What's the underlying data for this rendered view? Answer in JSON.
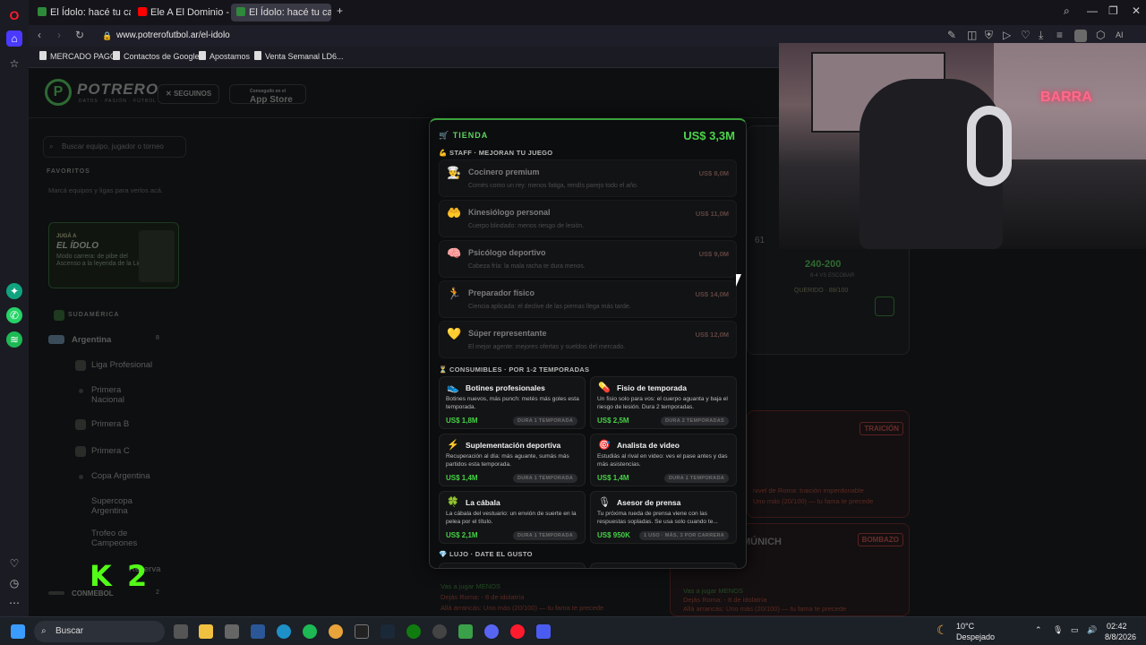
{
  "browser": {
    "tabs": [
      {
        "label": "El Ídolo: hacé tu carrera e",
        "active": false,
        "icon": "potrero-favicon"
      },
      {
        "label": "Ele A El Dominio - Ha",
        "active": false,
        "icon": "youtube-icon"
      },
      {
        "label": "El Ídolo: hacé tu carrera e",
        "active": true,
        "icon": "potrero-favicon"
      }
    ],
    "url": "www.potrerofutbol.ar/el-idolo",
    "bookmarks": [
      "MERCADO PAGO",
      "Contactos de Google",
      "Apostamos",
      "Venta Semanal LD6..."
    ],
    "ai_label": "AI"
  },
  "site": {
    "logo_text": "POTRERO",
    "logo_sub": "DATOS · PASIÓN · FÚTBOL",
    "follow_label": "SEGUINOS",
    "appstore_small": "Conseguilo en el",
    "appstore_label": "App Store",
    "search_placeholder": "Buscar equipo, jugador o torneo",
    "favorites_caption": "FAVORITOS",
    "favorites_note": "Marcá equipos y ligas para verlos acá.",
    "promo": {
      "kicker": "JUGÁ A",
      "title": "EL ÍDOLO",
      "desc": "Modo carrera: de pibe del Ascenso a la leyenda de la Liga"
    },
    "region": "SUDAMÉRICA",
    "country": "Argentina",
    "country_count": "8",
    "nav": [
      "Liga Profesional",
      "Primera Nacional",
      "Primera B",
      "Primera C",
      "Copa Argentina",
      "Supercopa Argentina",
      "Trofeo de Campeones",
      "Reserva"
    ],
    "conmebol": "CONMEBOL",
    "conmebol_count": "2",
    "right_card": {
      "score": "61",
      "record": "240-200",
      "sub": "8-4 VS ESCOBAR",
      "mood": "QUERIDO · 88/100"
    },
    "badges": [
      "TRAICIÓN",
      "BOMBAZO"
    ],
    "munich": "MÚNICH",
    "bg_lines": [
      "nivel de Roma: traición imperdonable",
      "Uno más (20/100) — tu fama te precede",
      "Vas a jugar MENOS",
      "Dejás Roma: - 8 de idolatría",
      "Allá arrancás: Uno más (20/100) — tu fama te precede"
    ]
  },
  "store": {
    "title": "TIENDA",
    "balance": "US$ 3,3M",
    "staff_caption": "STAFF · MEJORAN TU JUEGO",
    "staff": [
      {
        "icon": "chef-icon",
        "glyph": "👨‍🍳",
        "name": "Cocinero premium",
        "desc": "Comés como un rey: menos fatiga, rendís parejo todo el año.",
        "price": "US$ 8,0M"
      },
      {
        "icon": "physio-icon",
        "glyph": "🤲",
        "name": "Kinesiólogo personal",
        "desc": "Cuerpo blindado: menos riesgo de lesión.",
        "price": "US$ 11,0M"
      },
      {
        "icon": "brain-icon",
        "glyph": "🧠",
        "name": "Psicólogo deportivo",
        "desc": "Cabeza fría: la mala racha te dura menos.",
        "price": "US$ 9,0M"
      },
      {
        "icon": "trainer-icon",
        "glyph": "🏃",
        "name": "Preparador físico",
        "desc": "Ciencia aplicada: el declive de las piernas llega más tarde.",
        "price": "US$ 14,0M"
      },
      {
        "icon": "heart-icon",
        "glyph": "💛",
        "name": "Súper representante",
        "desc": "El mejor agente: mejores ofertas y sueldos del mercado.",
        "price": "US$ 12,0M"
      }
    ],
    "consumables_caption": "CONSUMIBLES · POR 1-2 TEMPORADAS",
    "consumables": [
      {
        "icon": "boot-icon",
        "glyph": "👟",
        "name": "Botines profesionales",
        "desc": "Botines nuevos, más punch: metés más goles esta temporada.",
        "price": "US$ 1,8M",
        "tag": "DURA 1 TEMPORADA"
      },
      {
        "icon": "pill-icon",
        "glyph": "💊",
        "name": "Fisio de temporada",
        "desc": "Un fisio solo para vos: el cuerpo aguanta y baja el riesgo de lesión. Dura 2 temporadas.",
        "price": "US$ 2,5M",
        "tag": "DURA 2 TEMPORADAS"
      },
      {
        "icon": "bolt-icon",
        "glyph": "⚡",
        "name": "Suplementación deportiva",
        "desc": "Recuperación al día: más aguante, sumás más partidos esta temporada.",
        "price": "US$ 1,4M",
        "tag": "DURA 1 TEMPORADA"
      },
      {
        "icon": "target-icon",
        "glyph": "🎯",
        "name": "Analista de video",
        "desc": "Estudiás al rival en video: ves el pase antes y das más asistencias.",
        "price": "US$ 1,4M",
        "tag": "DURA 1 TEMPORADA"
      },
      {
        "icon": "clover-icon",
        "glyph": "🍀",
        "name": "La cábala",
        "desc": "La cábala del vestuario: un envión de suerte en la pelea por el título.",
        "price": "US$ 2,1M",
        "tag": "DURA 1 TEMPORADA"
      },
      {
        "icon": "microphone-icon",
        "glyph": "🎙",
        "name": "Asesor de prensa",
        "desc": "Tu próxima rueda de prensa viene con las respuestas sopladas. Se usa solo cuando te...",
        "price": "US$ 950K",
        "tag": "1 USO · MÁS, 3 POR CARRERA"
      }
    ],
    "luxury_caption": "LUJO · DATE EL GUSTO"
  },
  "stream_overlay": {
    "neon_sign": "BARRA",
    "kick": "K 2"
  },
  "taskbar": {
    "search": "Buscar",
    "weather_temp": "10°C",
    "weather_desc": "Despejado",
    "time": "02:42",
    "date": "8/8/2026"
  },
  "colors": {
    "accent_green": "#3aa23a",
    "price_green": "#46d146",
    "kick_green": "#53fc18"
  }
}
